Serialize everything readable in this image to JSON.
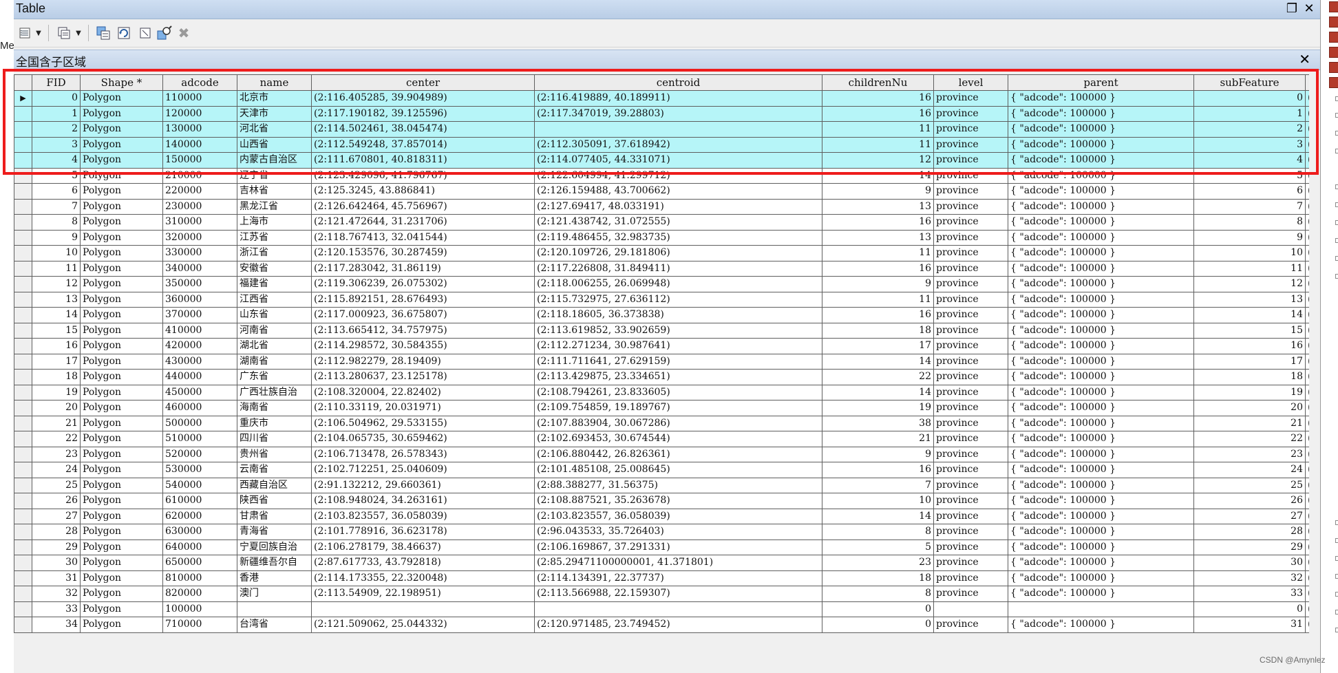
{
  "window": {
    "title": "Table",
    "maximize_glyph": "❐",
    "close_glyph": "✕"
  },
  "left_fragment": "Me",
  "tab": {
    "name": "全国含子区域",
    "close_glyph": "✕"
  },
  "toolbar": {
    "icons": [
      "table-options-icon",
      "dropdown-arrow-icon",
      "related-tables-icon",
      "dropdown-arrow-icon",
      "select-by-attributes-icon",
      "switch-selection-icon",
      "clear-selection-icon",
      "zoom-to-selected-icon",
      "delete-selected-icon"
    ]
  },
  "table": {
    "columns": [
      "FID",
      "Shape *",
      "adcode",
      "name",
      "center",
      "centroid",
      "childrenNu",
      "level",
      "parent",
      "subFeature"
    ],
    "rows": [
      [
        "0",
        "Polygon",
        "110000",
        "北京市",
        "(2:116.405285, 39.904989)",
        "(2:116.419889, 40.189911)",
        "16",
        "province",
        "{ \"adcode\": 100000 }",
        "0"
      ],
      [
        "1",
        "Polygon",
        "120000",
        "天津市",
        "(2:117.190182, 39.125596)",
        "(2:117.347019, 39.28803)",
        "16",
        "province",
        "{ \"adcode\": 100000 }",
        "1"
      ],
      [
        "2",
        "Polygon",
        "130000",
        "河北省",
        "(2:114.502461, 38.045474)",
        "",
        "11",
        "province",
        "{ \"adcode\": 100000 }",
        "2"
      ],
      [
        "3",
        "Polygon",
        "140000",
        "山西省",
        "(2:112.549248, 37.857014)",
        "(2:112.305091, 37.618942)",
        "11",
        "province",
        "{ \"adcode\": 100000 }",
        "3"
      ],
      [
        "4",
        "Polygon",
        "150000",
        "内蒙古自治区",
        "(2:111.670801, 40.818311)",
        "(2:114.077405, 44.331071)",
        "12",
        "province",
        "{ \"adcode\": 100000 }",
        "4"
      ],
      [
        "5",
        "Polygon",
        "210000",
        "辽宁省",
        "(2:123.429096, 41.796767)",
        "(2:122.604994, 41.299712)",
        "14",
        "province",
        "{ \"adcode\": 100000 }",
        "5"
      ],
      [
        "6",
        "Polygon",
        "220000",
        "吉林省",
        "(2:125.3245, 43.886841)",
        "(2:126.159488, 43.700662)",
        "9",
        "province",
        "{ \"adcode\": 100000 }",
        "6"
      ],
      [
        "7",
        "Polygon",
        "230000",
        "黑龙江省",
        "(2:126.642464, 45.756967)",
        "(2:127.69417, 48.033191)",
        "13",
        "province",
        "{ \"adcode\": 100000 }",
        "7"
      ],
      [
        "8",
        "Polygon",
        "310000",
        "上海市",
        "(2:121.472644, 31.231706)",
        "(2:121.438742, 31.072555)",
        "16",
        "province",
        "{ \"adcode\": 100000 }",
        "8"
      ],
      [
        "9",
        "Polygon",
        "320000",
        "江苏省",
        "(2:118.767413, 32.041544)",
        "(2:119.486455, 32.983735)",
        "13",
        "province",
        "{ \"adcode\": 100000 }",
        "9"
      ],
      [
        "10",
        "Polygon",
        "330000",
        "浙江省",
        "(2:120.153576, 30.287459)",
        "(2:120.109726, 29.181806)",
        "11",
        "province",
        "{ \"adcode\": 100000 }",
        "10"
      ],
      [
        "11",
        "Polygon",
        "340000",
        "安徽省",
        "(2:117.283042, 31.86119)",
        "(2:117.226808, 31.849411)",
        "16",
        "province",
        "{ \"adcode\": 100000 }",
        "11"
      ],
      [
        "12",
        "Polygon",
        "350000",
        "福建省",
        "(2:119.306239, 26.075302)",
        "(2:118.006255, 26.069948)",
        "9",
        "province",
        "{ \"adcode\": 100000 }",
        "12"
      ],
      [
        "13",
        "Polygon",
        "360000",
        "江西省",
        "(2:115.892151, 28.676493)",
        "(2:115.732975, 27.636112)",
        "11",
        "province",
        "{ \"adcode\": 100000 }",
        "13"
      ],
      [
        "14",
        "Polygon",
        "370000",
        "山东省",
        "(2:117.000923, 36.675807)",
        "(2:118.18605, 36.373838)",
        "16",
        "province",
        "{ \"adcode\": 100000 }",
        "14"
      ],
      [
        "15",
        "Polygon",
        "410000",
        "河南省",
        "(2:113.665412, 34.757975)",
        "(2:113.619852, 33.902659)",
        "18",
        "province",
        "{ \"adcode\": 100000 }",
        "15"
      ],
      [
        "16",
        "Polygon",
        "420000",
        "湖北省",
        "(2:114.298572, 30.584355)",
        "(2:112.271234, 30.987641)",
        "17",
        "province",
        "{ \"adcode\": 100000 }",
        "16"
      ],
      [
        "17",
        "Polygon",
        "430000",
        "湖南省",
        "(2:112.982279, 28.19409)",
        "(2:111.711641, 27.629159)",
        "14",
        "province",
        "{ \"adcode\": 100000 }",
        "17"
      ],
      [
        "18",
        "Polygon",
        "440000",
        "广东省",
        "(2:113.280637, 23.125178)",
        "(2:113.429875, 23.334651)",
        "22",
        "province",
        "{ \"adcode\": 100000 }",
        "18"
      ],
      [
        "19",
        "Polygon",
        "450000",
        "广西壮族自治",
        "(2:108.320004, 22.82402)",
        "(2:108.794261, 23.833605)",
        "14",
        "province",
        "{ \"adcode\": 100000 }",
        "19"
      ],
      [
        "20",
        "Polygon",
        "460000",
        "海南省",
        "(2:110.33119, 20.031971)",
        "(2:109.754859, 19.189767)",
        "19",
        "province",
        "{ \"adcode\": 100000 }",
        "20"
      ],
      [
        "21",
        "Polygon",
        "500000",
        "重庆市",
        "(2:106.504962, 29.533155)",
        "(2:107.883904, 30.067286)",
        "38",
        "province",
        "{ \"adcode\": 100000 }",
        "21"
      ],
      [
        "22",
        "Polygon",
        "510000",
        "四川省",
        "(2:104.065735, 30.659462)",
        "(2:102.693453, 30.674544)",
        "21",
        "province",
        "{ \"adcode\": 100000 }",
        "22"
      ],
      [
        "23",
        "Polygon",
        "520000",
        "贵州省",
        "(2:106.713478, 26.578343)",
        "(2:106.880442, 26.826361)",
        "9",
        "province",
        "{ \"adcode\": 100000 }",
        "23"
      ],
      [
        "24",
        "Polygon",
        "530000",
        "云南省",
        "(2:102.712251, 25.040609)",
        "(2:101.485108, 25.008645)",
        "16",
        "province",
        "{ \"adcode\": 100000 }",
        "24"
      ],
      [
        "25",
        "Polygon",
        "540000",
        "西藏自治区",
        "(2:91.132212, 29.660361)",
        "(2:88.388277, 31.56375)",
        "7",
        "province",
        "{ \"adcode\": 100000 }",
        "25"
      ],
      [
        "26",
        "Polygon",
        "610000",
        "陕西省",
        "(2:108.948024, 34.263161)",
        "(2:108.887521, 35.263678)",
        "10",
        "province",
        "{ \"adcode\": 100000 }",
        "26"
      ],
      [
        "27",
        "Polygon",
        "620000",
        "甘肃省",
        "(2:103.823557, 36.058039)",
        "(2:103.823557, 36.058039)",
        "14",
        "province",
        "{ \"adcode\": 100000 }",
        "27"
      ],
      [
        "28",
        "Polygon",
        "630000",
        "青海省",
        "(2:101.778916, 36.623178)",
        "(2:96.043533, 35.726403)",
        "8",
        "province",
        "{ \"adcode\": 100000 }",
        "28"
      ],
      [
        "29",
        "Polygon",
        "640000",
        "宁夏回族自治",
        "(2:106.278179, 38.46637)",
        "(2:106.169867, 37.291331)",
        "5",
        "province",
        "{ \"adcode\": 100000 }",
        "29"
      ],
      [
        "30",
        "Polygon",
        "650000",
        "新疆维吾尔自",
        "(2:87.617733, 43.792818)",
        "(2:85.29471100000001, 41.371801)",
        "23",
        "province",
        "{ \"adcode\": 100000 }",
        "30"
      ],
      [
        "31",
        "Polygon",
        "810000",
        "香港",
        "(2:114.173355, 22.320048)",
        "(2:114.134391, 22.37737)",
        "18",
        "province",
        "{ \"adcode\": 100000 }",
        "32"
      ],
      [
        "32",
        "Polygon",
        "820000",
        "澳门",
        "(2:113.54909, 22.198951)",
        "(2:113.566988, 22.159307)",
        "8",
        "province",
        "{ \"adcode\": 100000 }",
        "33"
      ],
      [
        "33",
        "Polygon",
        "100000",
        "",
        "",
        "",
        "0",
        "",
        "",
        "0"
      ],
      [
        "34",
        "Polygon",
        "710000",
        "台湾省",
        "(2:121.509062, 25.044332)",
        "(2:120.971485, 23.749452)",
        "0",
        "province",
        "{ \"adcode\": 100000 }",
        "31"
      ]
    ],
    "selected_count": 5,
    "active_row_marker": "▶",
    "overflow_glyph": "("
  },
  "watermark": "CSDN @Amynlez",
  "colors": {
    "selected_row": "#b6f5f8",
    "highlight_box": "#ee1c1c",
    "titlebar": "#c3d6ee"
  }
}
